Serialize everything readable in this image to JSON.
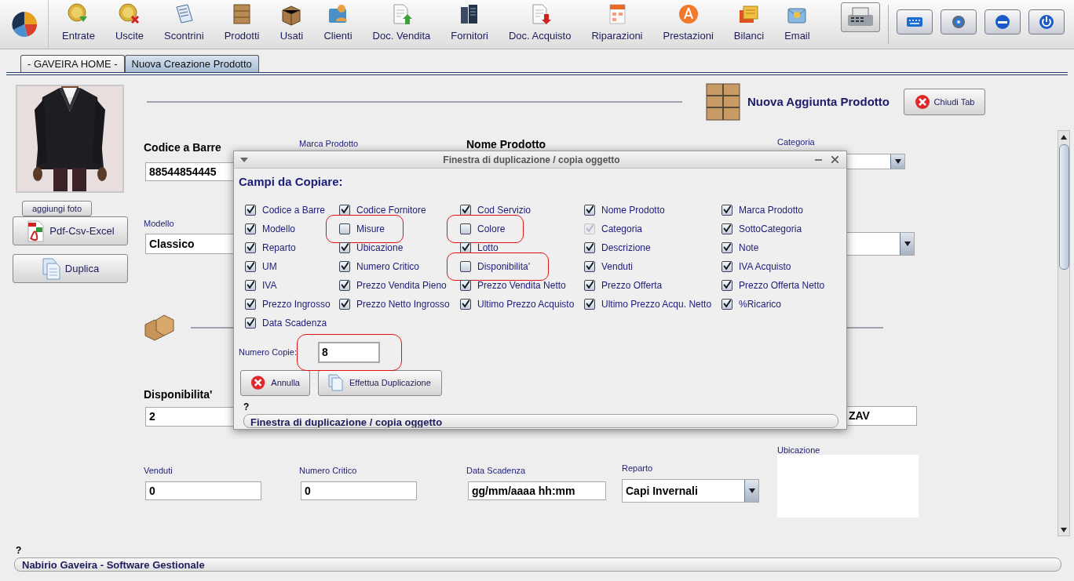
{
  "toolbar": {
    "items": [
      {
        "label": "Entrate"
      },
      {
        "label": "Uscite"
      },
      {
        "label": "Scontrini"
      },
      {
        "label": "Prodotti"
      },
      {
        "label": "Usati"
      },
      {
        "label": "Clienti"
      },
      {
        "label": "Doc. Vendita"
      },
      {
        "label": "Fornitori"
      },
      {
        "label": "Doc. Acquisto"
      },
      {
        "label": "Riparazioni"
      },
      {
        "label": "Prestazioni"
      },
      {
        "label": "Bilanci"
      },
      {
        "label": "Email"
      }
    ]
  },
  "tabs": [
    {
      "label": "- GAVEIRA HOME -",
      "selected": false
    },
    {
      "label": "Nuova Creazione Prodotto",
      "selected": true
    }
  ],
  "sidebar": {
    "photo_button": "aggiungi foto",
    "buttons": [
      "Pdf-Csv-Excel",
      "Duplica"
    ]
  },
  "header": {
    "title": "Nuova Aggiunta Prodotto",
    "close_button": "Chiudi Tab"
  },
  "form": {
    "codice_a_barre": {
      "label": "Codice a Barre",
      "value": "88544854445"
    },
    "marca_prodotto": {
      "label": "Marca Prodotto"
    },
    "nome_prodotto": {
      "label": "Nome Prodotto"
    },
    "categoria": {
      "label": "Categoria"
    },
    "modello": {
      "label": "Modello",
      "value": "Classico"
    },
    "disponibilita": {
      "label": "Disponibilita'",
      "value": "2"
    },
    "field_right": {
      "value": "ZAV"
    },
    "venduti": {
      "label": "Venduti",
      "value": "0"
    },
    "numero_critico": {
      "label": "Numero Critico",
      "value": "0"
    },
    "data_scadenza": {
      "label": "Data Scadenza",
      "value": "gg/mm/aaaa hh:mm"
    },
    "reparto": {
      "label": "Reparto",
      "value": "Capi Invernali"
    },
    "ubicazione": {
      "label": "Ubicazione"
    }
  },
  "dialog": {
    "title": "Finestra di duplicazione / copia oggetto",
    "heading": "Campi da Copiare:",
    "fields": [
      {
        "label": "Codice a Barre",
        "checked": true,
        "disabled": false,
        "highlighted": false
      },
      {
        "label": "Codice Fornitore",
        "checked": true,
        "disabled": false,
        "highlighted": false
      },
      {
        "label": "Cod Servizio",
        "checked": true,
        "disabled": false,
        "highlighted": false
      },
      {
        "label": "Nome Prodotto",
        "checked": true,
        "disabled": false,
        "highlighted": false
      },
      {
        "label": "Marca Prodotto",
        "checked": true,
        "disabled": false,
        "highlighted": false
      },
      {
        "label": "Modello",
        "checked": true,
        "disabled": false,
        "highlighted": false
      },
      {
        "label": "Misure",
        "checked": false,
        "disabled": false,
        "highlighted": true
      },
      {
        "label": "Colore",
        "checked": false,
        "disabled": false,
        "highlighted": true
      },
      {
        "label": "Categoria",
        "checked": true,
        "disabled": true,
        "highlighted": false
      },
      {
        "label": "SottoCategoria",
        "checked": true,
        "disabled": false,
        "highlighted": false
      },
      {
        "label": "Reparto",
        "checked": true,
        "disabled": false,
        "highlighted": false
      },
      {
        "label": "Ubicazione",
        "checked": true,
        "disabled": false,
        "highlighted": false
      },
      {
        "label": "Lotto",
        "checked": true,
        "disabled": false,
        "highlighted": false
      },
      {
        "label": "Descrizione",
        "checked": true,
        "disabled": false,
        "highlighted": false
      },
      {
        "label": "Note",
        "checked": true,
        "disabled": false,
        "highlighted": false
      },
      {
        "label": "UM",
        "checked": true,
        "disabled": false,
        "highlighted": false
      },
      {
        "label": "Numero Critico",
        "checked": true,
        "disabled": false,
        "highlighted": false
      },
      {
        "label": "Disponibilita'",
        "checked": false,
        "disabled": false,
        "highlighted": true
      },
      {
        "label": "Venduti",
        "checked": true,
        "disabled": false,
        "highlighted": false
      },
      {
        "label": "IVA Acquisto",
        "checked": true,
        "disabled": false,
        "highlighted": false
      },
      {
        "label": "IVA",
        "checked": true,
        "disabled": false,
        "highlighted": false
      },
      {
        "label": "Prezzo Vendita Pieno",
        "checked": true,
        "disabled": false,
        "highlighted": false
      },
      {
        "label": "Prezzo Vendita Netto",
        "checked": true,
        "disabled": false,
        "highlighted": false
      },
      {
        "label": "Prezzo Offerta",
        "checked": true,
        "disabled": false,
        "highlighted": false
      },
      {
        "label": "Prezzo Offerta Netto",
        "checked": true,
        "disabled": false,
        "highlighted": false
      },
      {
        "label": "Prezzo Ingrosso",
        "checked": true,
        "disabled": false,
        "highlighted": false
      },
      {
        "label": "Prezzo Netto Ingrosso",
        "checked": true,
        "disabled": false,
        "highlighted": false
      },
      {
        "label": "Ultimo Prezzo Acquisto",
        "checked": true,
        "disabled": false,
        "highlighted": false
      },
      {
        "label": "Ultimo Prezzo Acqu. Netto",
        "checked": true,
        "disabled": false,
        "highlighted": false
      },
      {
        "label": "%Ricarico",
        "checked": true,
        "disabled": false,
        "highlighted": false
      },
      {
        "label": "Data Scadenza",
        "checked": true,
        "disabled": false,
        "highlighted": false
      }
    ],
    "copies": {
      "label": "Numero Copie:",
      "value": "8",
      "highlighted": true
    },
    "buttons": [
      "Annulla",
      "Effettua Duplicazione"
    ],
    "hint": "?",
    "status": "Finestra di duplicazione / copia oggetto"
  },
  "status_bar": {
    "hint": "?",
    "text": "Nabirio Gaveira - Software Gestionale"
  }
}
